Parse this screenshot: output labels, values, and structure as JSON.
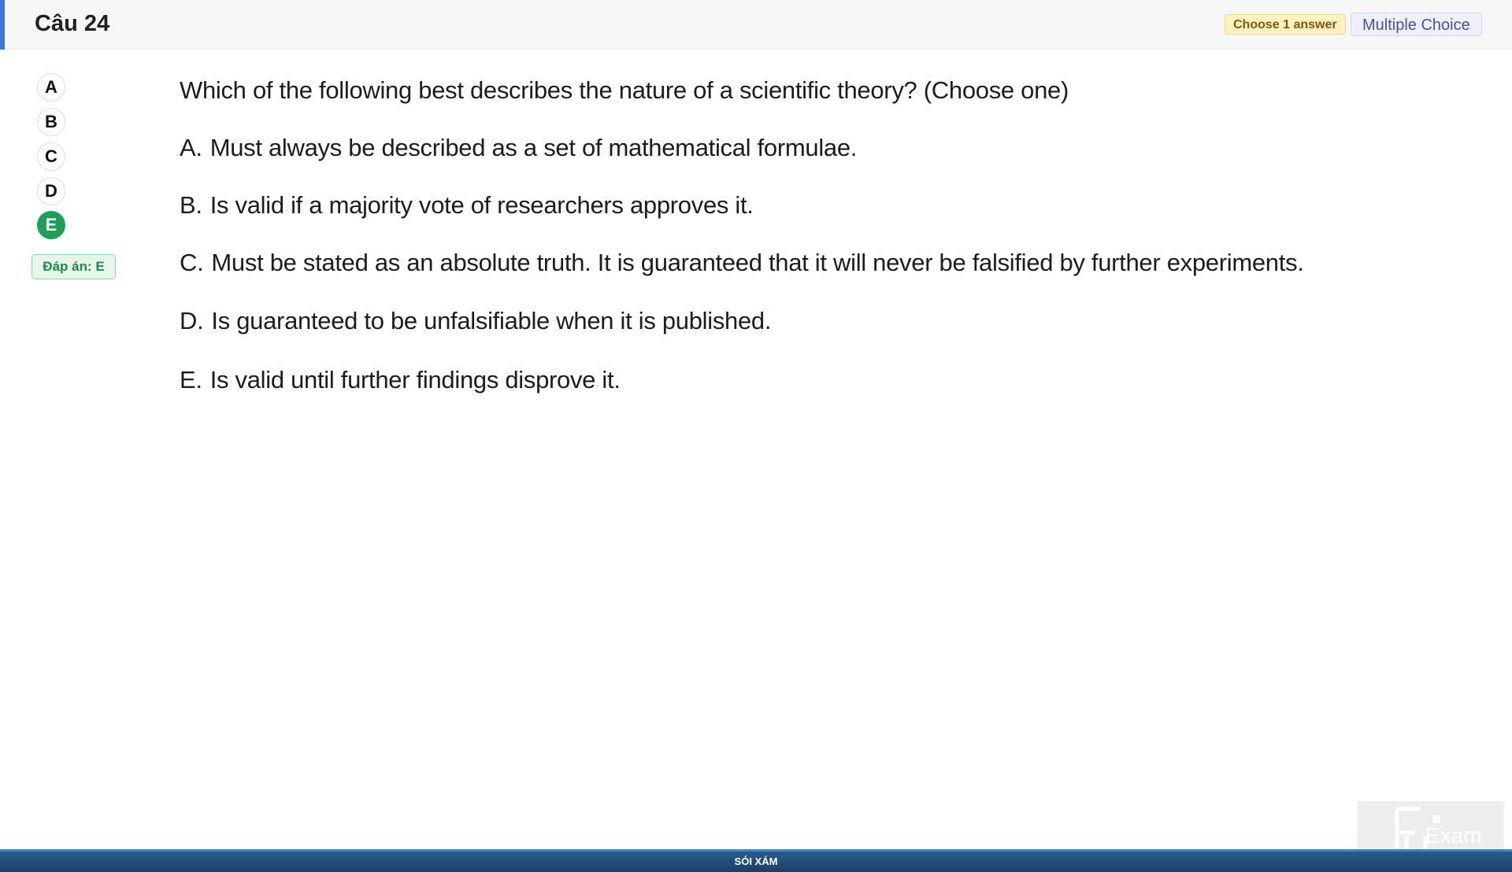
{
  "header": {
    "title": "Câu 24",
    "answer_count_badge": "Choose 1 answer",
    "type_badge": "Multiple Choice"
  },
  "selector": {
    "options": [
      "A",
      "B",
      "C",
      "D",
      "E"
    ],
    "selected": "E",
    "answer_label": "Đáp án: E"
  },
  "question": {
    "text": "Which of the following best describes the nature of a scientific theory? (Choose one)",
    "choices": [
      {
        "letter": "A.",
        "text": "Must always be described as a set of mathematical formulae."
      },
      {
        "letter": "B.",
        "text": "Is valid if a majority vote of researchers approves it."
      },
      {
        "letter": "C.",
        "text": "Must be stated as an absolute truth. It is guaranteed that it will never be falsified by further experiments."
      },
      {
        "letter": "D.",
        "text": "Is guaranteed to be unfalsifiable when it is published."
      },
      {
        "letter": "E.",
        "text": "Is valid until further findings disprove it."
      }
    ]
  },
  "footer": {
    "label": "SÓI XÁM"
  },
  "logo": {
    "brand_text": "Exam"
  },
  "colors": {
    "accent": "#3a78e0",
    "selected_green": "#1e9e56",
    "footer_blue": "#1c3d66"
  }
}
